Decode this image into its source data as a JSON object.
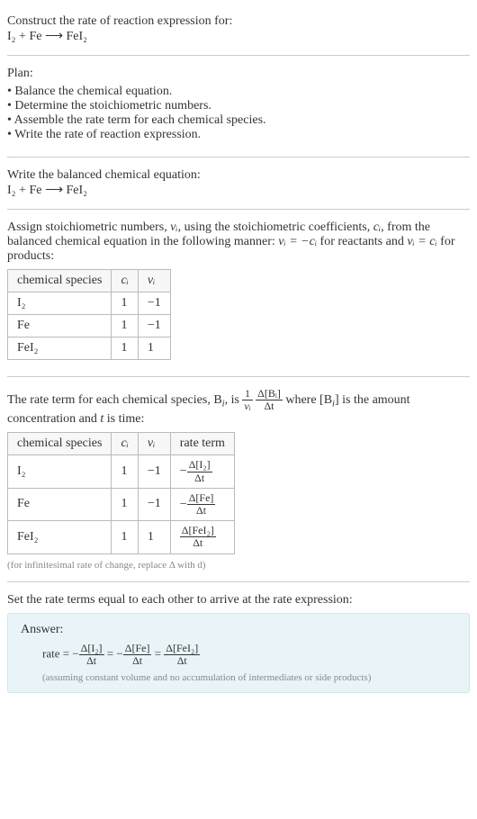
{
  "header": {
    "title": "Construct the rate of reaction expression for:",
    "equation": "I₂ + Fe ⟶ FeI₂"
  },
  "plan": {
    "title": "Plan:",
    "items": [
      "Balance the chemical equation.",
      "Determine the stoichiometric numbers.",
      "Assemble the rate term for each chemical species.",
      "Write the rate of reaction expression."
    ]
  },
  "balanced": {
    "title": "Write the balanced chemical equation:",
    "equation": "I₂ + Fe ⟶ FeI₂"
  },
  "stoich": {
    "intro_a": "Assign stoichiometric numbers, ",
    "intro_b": ", using the stoichiometric coefficients, ",
    "intro_c": ", from the balanced chemical equation in the following manner: ",
    "intro_d": " for reactants and ",
    "intro_e": " for products:",
    "nu": "νᵢ",
    "ci": "cᵢ",
    "rel_reactants": "νᵢ = −cᵢ",
    "rel_products": "νᵢ = cᵢ",
    "headers": [
      "chemical species",
      "cᵢ",
      "νᵢ"
    ],
    "rows": [
      {
        "species": "I₂",
        "c": "1",
        "nu": "−1"
      },
      {
        "species": "Fe",
        "c": "1",
        "nu": "−1"
      },
      {
        "species": "FeI₂",
        "c": "1",
        "nu": "1"
      }
    ]
  },
  "rateterm": {
    "intro_a": "The rate term for each chemical species, B",
    "intro_b": ", is ",
    "intro_c": " where [B",
    "intro_d": "] is the amount concentration and ",
    "intro_e": " is time:",
    "tvar": "t",
    "frac1_num": "1",
    "frac1_den": "νᵢ",
    "frac2_num": "Δ[Bᵢ]",
    "frac2_den": "Δt",
    "headers": [
      "chemical species",
      "cᵢ",
      "νᵢ",
      "rate term"
    ],
    "rows": [
      {
        "species": "I₂",
        "c": "1",
        "nu": "−1",
        "rate_num": "Δ[I₂]",
        "rate_den": "Δt",
        "neg": "−"
      },
      {
        "species": "Fe",
        "c": "1",
        "nu": "−1",
        "rate_num": "Δ[Fe]",
        "rate_den": "Δt",
        "neg": "−"
      },
      {
        "species": "FeI₂",
        "c": "1",
        "nu": "1",
        "rate_num": "Δ[FeI₂]",
        "rate_den": "Δt",
        "neg": ""
      }
    ],
    "note": "(for infinitesimal rate of change, replace Δ with d)"
  },
  "final": {
    "title": "Set the rate terms equal to each other to arrive at the rate expression:",
    "answer_label": "Answer:",
    "rate_label": "rate = ",
    "terms": [
      {
        "neg": "−",
        "num": "Δ[I₂]",
        "den": "Δt"
      },
      {
        "neg": "−",
        "num": "Δ[Fe]",
        "den": "Δt"
      },
      {
        "neg": "",
        "num": "Δ[FeI₂]",
        "den": "Δt"
      }
    ],
    "eq": " = ",
    "note": "(assuming constant volume and no accumulation of intermediates or side products)"
  }
}
